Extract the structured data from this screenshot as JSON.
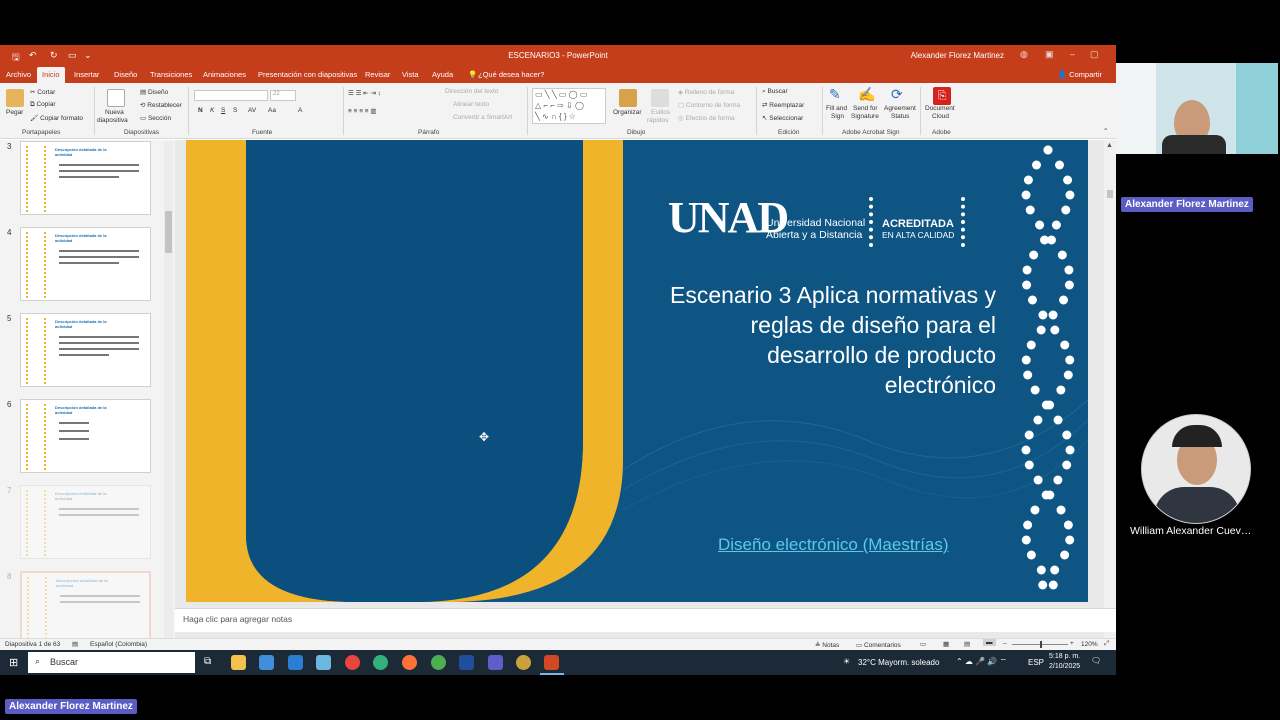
{
  "app": {
    "title": "ESCENARIO3  -  PowerPoint",
    "user": "Alexander Florez Martinez"
  },
  "menu": {
    "items": [
      "Archivo",
      "Inicio",
      "Insertar",
      "Diseño",
      "Transiciones",
      "Animaciones",
      "Presentación con diapositivas",
      "Revisar",
      "Vista",
      "Ayuda"
    ],
    "tell_me": "¿Qué desea hacer?",
    "share": "Compartir"
  },
  "ribbon": {
    "portapapeles": {
      "pegar": "Pegar",
      "cortar": "Cortar",
      "copiar": "Copiar",
      "copiar_formato": "Copiar formato",
      "label": "Portapapeles"
    },
    "diapositivas": {
      "nueva": "Nueva",
      "diapositiva": "diapositiva",
      "diseno": "Diseño",
      "restablecer": "Restablecer",
      "seccion": "Sección",
      "label": "Diapositivas"
    },
    "fuente": {
      "size": "22",
      "label": "Fuente"
    },
    "parrafo": {
      "direccion": "Dirección del texto",
      "alinear": "Alinear texto",
      "smartart": "Convertir a SmartArt",
      "label": "Párrafo"
    },
    "dibujo": {
      "organizar": "Organizar",
      "estilos": "Estilos",
      "rapidos": "rápidos",
      "relleno": "Relleno de forma",
      "contorno": "Contorno de forma",
      "efectos": "Efectos de forma",
      "label": "Dibujo"
    },
    "edicion": {
      "buscar": "Buscar",
      "reemplazar": "Reemplazar",
      "seleccionar": "Seleccionar",
      "label": "Edición"
    },
    "acrobat": {
      "fill": "Fill and",
      "sign": "Sign",
      "send": "Send for",
      "signature": "Signature",
      "agreement": "Agreement",
      "status": "Status",
      "label": "Adobe Acrobat Sign"
    },
    "adobe": {
      "document": "Document",
      "cloud": "Cloud",
      "label": "Adobe"
    }
  },
  "thumbnails": [
    {
      "num": "3",
      "title": "Descripción detallada de la actividad"
    },
    {
      "num": "4",
      "title": "Descripción detallada de la actividad"
    },
    {
      "num": "5",
      "title": "Descripción detallada de la actividad"
    },
    {
      "num": "6",
      "title": "Descripción detallada de la actividad"
    },
    {
      "num": "7",
      "title": "Descripción detallada de la actividad"
    },
    {
      "num": "8",
      "title": "Descripción detallada de la actividad"
    }
  ],
  "slide": {
    "logo": "UNAD",
    "university_line1": "Universidad Nacional",
    "university_line2": "Abierta y a Distancia",
    "accredited": "ACREDITADA",
    "quality": "EN ALTA CALIDAD",
    "title_line1": "Escenario 3 Aplica normativas y",
    "title_line2": "reglas de diseño para el",
    "title_line3": "desarrollo de producto",
    "title_line4": "electrónico",
    "link1": "Diseño electrónico",
    "link2": "(Maestrías)",
    "colors": {
      "background": "#0e5584",
      "accent": "#f0b42a"
    }
  },
  "notes": {
    "placeholder": "Haga clic para agregar notas"
  },
  "status": {
    "slide_count": "Diapositiva 1 de 63",
    "language": "Español (Colombia)",
    "notes": "Notas",
    "comments": "Comentarios",
    "zoom": "120%"
  },
  "taskbar": {
    "search": "Buscar",
    "weather": "32°C  Mayorm. soleado",
    "lang": "ESP",
    "time": "5:18 p. m.",
    "date": "2/10/2025"
  },
  "participants": {
    "presenter": "Alexander Florez Martinez",
    "other": "William Alexander Cuev…",
    "bottom_label": "Alexander Florez Martinez"
  }
}
